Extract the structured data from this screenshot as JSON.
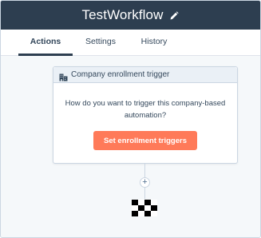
{
  "header": {
    "title": "TestWorkflow",
    "edit_icon": "pencil-icon"
  },
  "tabs": [
    {
      "label": "Actions",
      "active": true
    },
    {
      "label": "Settings",
      "active": false
    },
    {
      "label": "History",
      "active": false
    }
  ],
  "trigger_card": {
    "header_icon": "building-icon",
    "header_label": "Company enrollment trigger",
    "body_text": "How do you want to trigger this company-based automation?",
    "button_label": "Set enrollment triggers"
  },
  "flow": {
    "add_icon": "plus-icon",
    "add_label": "+",
    "end_icon": "checkered-flag-icon"
  },
  "colors": {
    "header_bg": "#2d3e50",
    "accent_orange": "#ff7a59",
    "card_header_bg": "#eaf0f6",
    "canvas_bg": "#f5f8fa",
    "text": "#33475b"
  }
}
